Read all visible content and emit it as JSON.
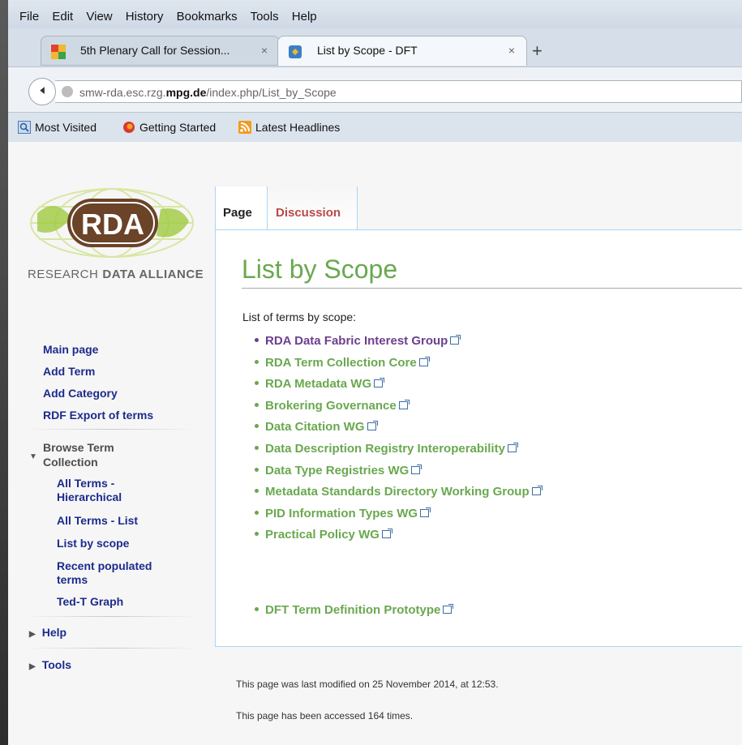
{
  "browser": {
    "menu": [
      "File",
      "Edit",
      "View",
      "History",
      "Bookmarks",
      "Tools",
      "Help"
    ],
    "tabs": [
      {
        "label": "5th Plenary Call for Session...",
        "active": false
      },
      {
        "label": "List by Scope - DFT",
        "active": true
      }
    ],
    "new_tab": "+",
    "close_glyph": "×",
    "url_prefix": "smw-rda.esc.rzg.",
    "url_domain": "mpg.de",
    "url_suffix": "/index.php/List_by_Scope",
    "bookmarks": [
      "Most Visited",
      "Getting Started",
      "Latest Headlines"
    ]
  },
  "logo": {
    "text": "RDA",
    "tagline_light": "RESEARCH",
    "tagline_bold": "DATA ALLIANCE"
  },
  "page_tabs": {
    "page": "Page",
    "discussion": "Discussion"
  },
  "main": {
    "title": "List by Scope",
    "intro": "List of terms by scope:",
    "terms": [
      "RDA Data Fabric Interest Group",
      "RDA Term Collection Core",
      "RDA Metadata WG",
      "Brokering Governance",
      "Data Citation WG",
      "Data Description Registry Interoperability",
      "Data Type Registries WG",
      "Metadata Standards Directory Working Group",
      "PID Information Types WG",
      "Practical Policy WG"
    ],
    "extra_term": "DFT Term Definition Prototype"
  },
  "sidebar": {
    "nav": [
      "Main page",
      "Add Term",
      "Add Category",
      "RDF Export of terms"
    ],
    "browse_heading": "Browse Term Collection",
    "browse_items": [
      "All Terms - Hierarchical",
      "All Terms - List",
      "List by scope",
      "Recent populated terms",
      "Ted-T Graph"
    ],
    "help": "Help",
    "tools": "Tools"
  },
  "footer": {
    "modified": "This page was last modified on 25 November 2014, at 12:53.",
    "accessed": "This page has been accessed 164 times."
  },
  "colors": {
    "link_green": "#6aa84f",
    "visited": "#6b3f8e",
    "nav_blue": "#1c2b8c"
  }
}
